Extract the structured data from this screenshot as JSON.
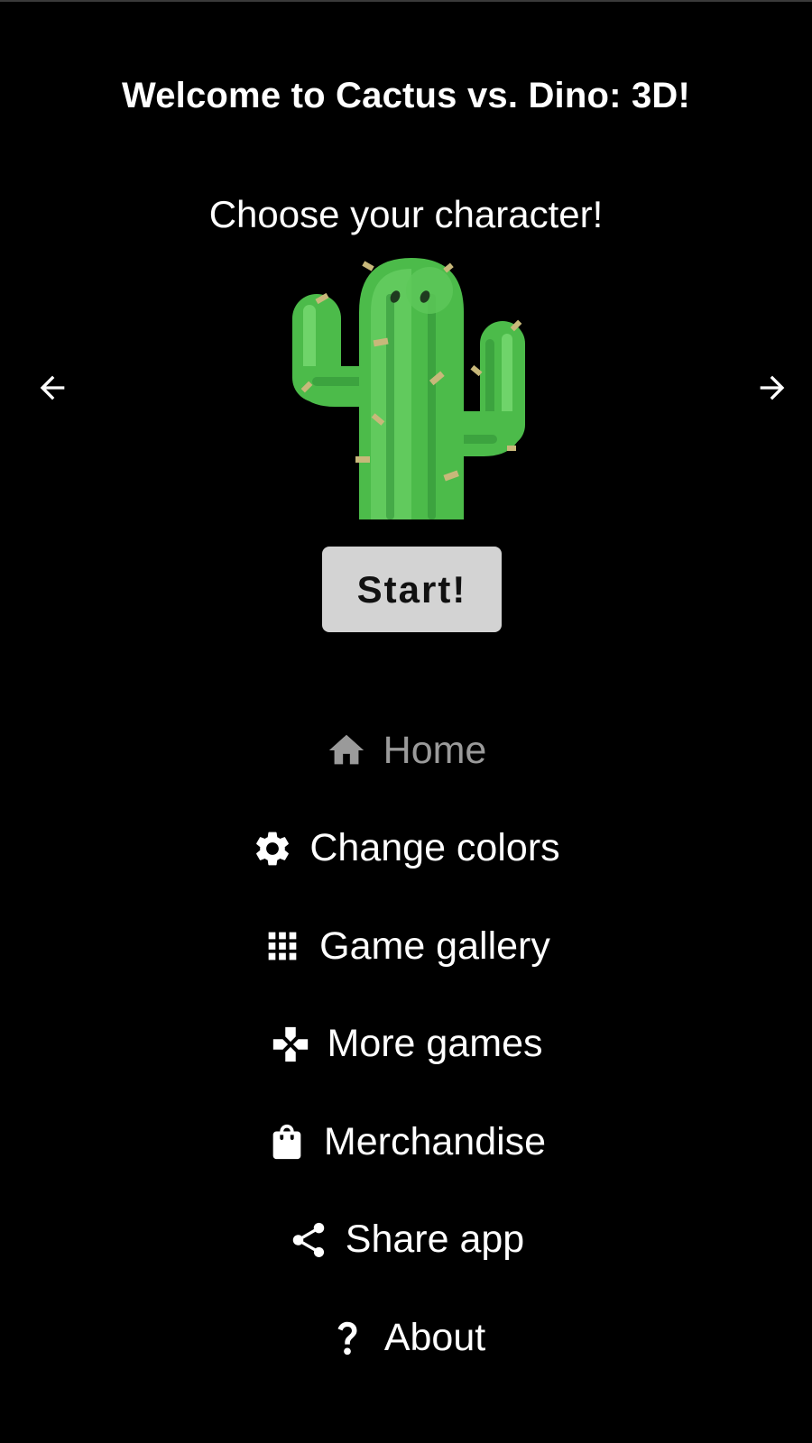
{
  "title": "Welcome to Cactus vs. Dino: 3D!",
  "subtitle": "Choose your character!",
  "character": {
    "name": "cactus",
    "colors": {
      "light": "#6fd46a",
      "mid": "#4cbb4a",
      "dark": "#2f8f37",
      "spine": "#c8b87a"
    }
  },
  "carousel": {
    "prev_icon": "arrow-left-icon",
    "next_icon": "arrow-right-icon"
  },
  "start_button": {
    "label": "Start!",
    "background": "#d3d3d3"
  },
  "menu": {
    "items": [
      {
        "label": "Home",
        "icon": "home-icon",
        "active": true
      },
      {
        "label": "Change colors",
        "icon": "gear-icon",
        "active": false
      },
      {
        "label": "Game gallery",
        "icon": "grid-icon",
        "active": false
      },
      {
        "label": "More games",
        "icon": "gamepad-icon",
        "active": false
      },
      {
        "label": "Merchandise",
        "icon": "shopping-bag-icon",
        "active": false
      },
      {
        "label": "Share app",
        "icon": "share-icon",
        "active": false
      },
      {
        "label": "About",
        "icon": "question-icon",
        "active": false
      }
    ]
  },
  "colors": {
    "background": "#000000",
    "text": "#ffffff",
    "active_menu_text": "#9a9a9a"
  }
}
